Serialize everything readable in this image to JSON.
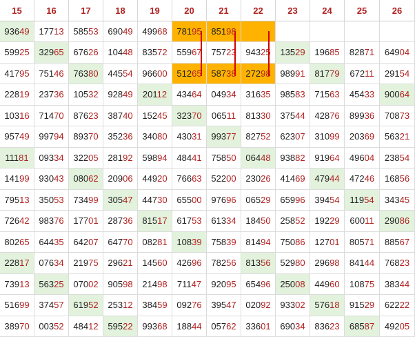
{
  "columns": [
    "15",
    "16",
    "17",
    "18",
    "19",
    "20",
    "21",
    "22",
    "23",
    "24",
    "25",
    "26"
  ],
  "rows": [
    [
      "93649",
      "17713",
      "58553",
      "69049",
      "49968",
      "78195",
      "85198",
      "",
      "",
      "",
      "",
      ""
    ],
    [
      "59925",
      "32965",
      "67626",
      "10448",
      "83572",
      "55967",
      "75723",
      "94325",
      "13529",
      "19685",
      "82871",
      "64904"
    ],
    [
      "41795",
      "75146",
      "76380",
      "44554",
      "96600",
      "51265",
      "58738",
      "27298",
      "98991",
      "81779",
      "67211",
      "29154"
    ],
    [
      "22819",
      "23736",
      "10532",
      "92849",
      "20112",
      "43464",
      "04934",
      "31635",
      "98583",
      "71563",
      "45433",
      "90064"
    ],
    [
      "10316",
      "71470",
      "87623",
      "38740",
      "15245",
      "32370",
      "06511",
      "81330",
      "37544",
      "42876",
      "89936",
      "70873"
    ],
    [
      "95749",
      "99794",
      "89370",
      "35236",
      "34080",
      "43031",
      "99377",
      "82752",
      "62307",
      "31099",
      "20369",
      "56321"
    ],
    [
      "11181",
      "09334",
      "32205",
      "28192",
      "59894",
      "48441",
      "75850",
      "06448",
      "93882",
      "91964",
      "49604",
      "23854"
    ],
    [
      "14199",
      "93043",
      "08062",
      "20906",
      "44920",
      "76663",
      "52200",
      "23026",
      "41469",
      "47944",
      "47246",
      "16856"
    ],
    [
      "79513",
      "35053",
      "73499",
      "30547",
      "44730",
      "65500",
      "97696",
      "06529",
      "65996",
      "39454",
      "11954",
      "34345"
    ],
    [
      "72642",
      "98376",
      "17701",
      "28736",
      "81517",
      "61753",
      "61334",
      "18450",
      "25852",
      "19229",
      "60011",
      "29086"
    ],
    [
      "80265",
      "64435",
      "64207",
      "64770",
      "08281",
      "10839",
      "75839",
      "81494",
      "75086",
      "12701",
      "80571",
      "88567"
    ],
    [
      "22817",
      "07634",
      "21975",
      "29621",
      "14560",
      "42696",
      "78256",
      "81356",
      "52980",
      "29698",
      "84144",
      "76823"
    ],
    [
      "73913",
      "56325",
      "07002",
      "90598",
      "21498",
      "71147",
      "92095",
      "65496",
      "25008",
      "44960",
      "10875",
      "38344"
    ],
    [
      "51699",
      "37457",
      "61952",
      "25312",
      "38459",
      "09276",
      "39547",
      "02092",
      "93302",
      "57618",
      "91529",
      "62222"
    ],
    [
      "38970",
      "00352",
      "48412",
      "59522",
      "99368",
      "18844",
      "05762",
      "33601",
      "69034",
      "83623",
      "68587",
      "49205"
    ]
  ],
  "highlights": {
    "green": [
      [
        0,
        0
      ],
      [
        1,
        1
      ],
      [
        1,
        8
      ],
      [
        2,
        2
      ],
      [
        2,
        9
      ],
      [
        3,
        4
      ],
      [
        3,
        11
      ],
      [
        4,
        5
      ],
      [
        5,
        6
      ],
      [
        6,
        0
      ],
      [
        6,
        7
      ],
      [
        7,
        2
      ],
      [
        7,
        9
      ],
      [
        8,
        3
      ],
      [
        8,
        10
      ],
      [
        9,
        4
      ],
      [
        9,
        11
      ],
      [
        10,
        5
      ],
      [
        11,
        0
      ],
      [
        11,
        7
      ],
      [
        12,
        1
      ],
      [
        12,
        8
      ],
      [
        13,
        2
      ],
      [
        13,
        9
      ],
      [
        14,
        3
      ],
      [
        14,
        10
      ]
    ],
    "orange": [
      [
        0,
        5
      ],
      [
        0,
        6
      ],
      [
        0,
        7
      ],
      [
        2,
        5
      ],
      [
        2,
        6
      ],
      [
        2,
        7
      ]
    ]
  },
  "marker_links": [
    [
      5,
      0,
      2
    ],
    [
      6,
      0,
      2
    ],
    [
      7,
      0,
      2
    ]
  ],
  "colors": {
    "header_text": "#b22222",
    "digit_dark": "#222222",
    "digit_red": "#b22222",
    "green_bg": "#e2f2dc",
    "orange_bg": "#ffb300",
    "marker": "#d40000"
  }
}
